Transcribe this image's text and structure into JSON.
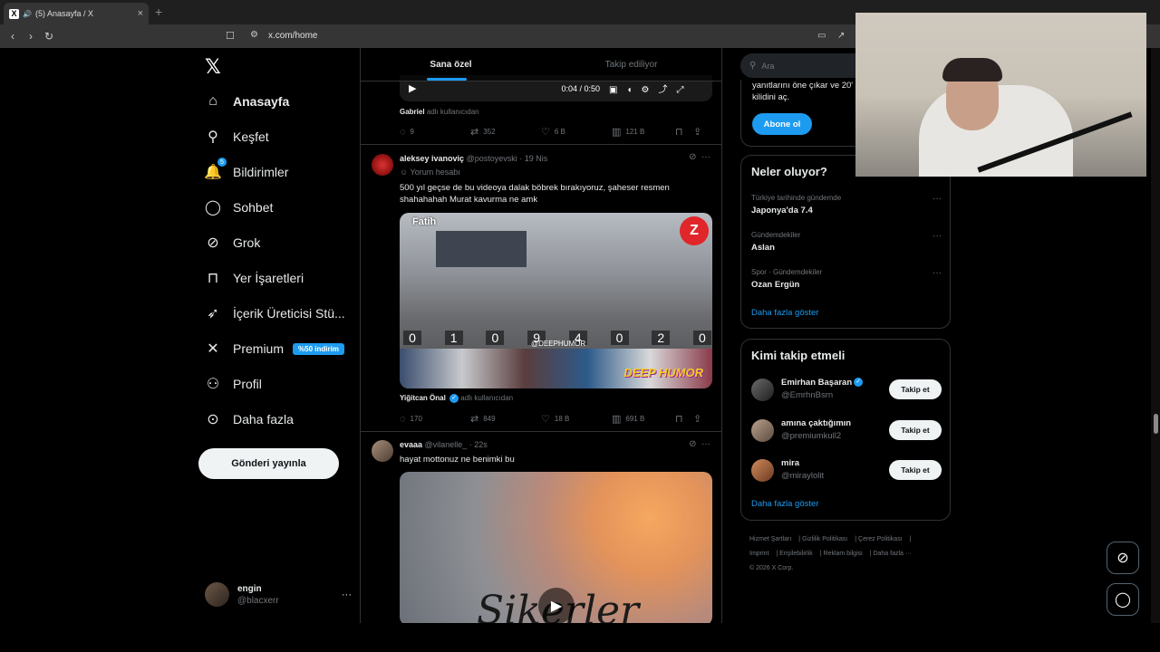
{
  "browser": {
    "tab_title": "(5) Anasayfa / X",
    "tab_icon": "x-logo-icon",
    "url": "x.com/home",
    "new_tab": "+"
  },
  "nav": {
    "items": [
      {
        "label": "Anasayfa",
        "icon": "home-icon",
        "active": true
      },
      {
        "label": "Keşfet",
        "icon": "search-icon"
      },
      {
        "label": "Bildirimler",
        "icon": "bell-icon",
        "badge": "5"
      },
      {
        "label": "Sohbet",
        "icon": "chat-icon"
      },
      {
        "label": "Grok",
        "icon": "grok-icon"
      },
      {
        "label": "Yer İşaretleri",
        "icon": "bookmark-icon"
      },
      {
        "label": "İçerik Üreticisi Stü...",
        "icon": "rocket-icon"
      },
      {
        "label": "Premium",
        "icon": "x-icon",
        "tag": "%50 indirim"
      },
      {
        "label": "Profil",
        "icon": "person-icon"
      },
      {
        "label": "Daha fazla",
        "icon": "more-circle-icon"
      }
    ],
    "post_button": "Gönderi yayınla",
    "account": {
      "name": "engin",
      "handle": "@blacxerr",
      "more": "···"
    }
  },
  "feed": {
    "tabs": [
      "Sana özel",
      "Takip ediliyor"
    ],
    "player": {
      "time": "0:04 / 0:50"
    },
    "prev_source": {
      "name": "Gabriel",
      "suffix": "adlı kullanıcıdan"
    },
    "prev_actions": {
      "replies": "9",
      "reposts": "352",
      "likes": "6 B",
      "views": "121 B"
    },
    "post1": {
      "name": "aleksey ivanoviç",
      "handle": "@postoyevski",
      "time": "· 19 Nis",
      "label": "Yorum hesabı",
      "text": "500 yıl geçse de bu videoya dalak böbrek bırakıyoruz, şaheser resmen shahahahah Murat kavurma ne amk",
      "media_tag": "Fatih",
      "media_brand": "Z",
      "digits": [
        "0",
        "1",
        "0",
        "9",
        "4",
        "0",
        "2",
        "0"
      ],
      "watermark": "@DEEPHUMOR",
      "deep": "DEEP HUMOR",
      "source": {
        "name": "Yiğitcan Önal",
        "suffix": "adlı kullanıcıdan"
      },
      "actions": {
        "replies": "170",
        "reposts": "849",
        "likes": "18 B",
        "views": "691 B"
      }
    },
    "post2": {
      "name": "evaaa",
      "handle": "@vilanelle_",
      "time": "· 22s",
      "text": "hayat mottonuz ne benimki bu",
      "media_text": "Sikerler"
    }
  },
  "right": {
    "search_placeholder": "Ara",
    "premium_text": "yanıtlarını öne çıkar ve 20' kilidini aç.",
    "subscribe": "Abone ol",
    "trends_title": "Neler oluyor?",
    "trends": [
      {
        "context": "Türkiye tarihinde gündemde",
        "name": "Japonya'da 7.4"
      },
      {
        "context": "Gündemdekiler",
        "name": "Aslan"
      },
      {
        "context": "Spor · Gündemdekiler",
        "name": "Ozan Ergün"
      }
    ],
    "show_more": "Daha fazla göster",
    "who_title": "Kimi takip etmeli",
    "who": [
      {
        "name": "Emirhan Başaran",
        "handle": "@EmrhnBsrn",
        "verified": true,
        "button": "Takip et"
      },
      {
        "name": "amına çaktığımın",
        "handle": "@premiumkull2",
        "button": "Takip et"
      },
      {
        "name": "mira",
        "handle": "@miraylolit",
        "button": "Takip et"
      }
    ],
    "who_more": "Daha fazla göster",
    "footer": [
      "Hizmet Şartları",
      "Gizlilik Politikası",
      "Çerez Politikası",
      "Imprint",
      "Erişilebilirlik",
      "Reklam bilgisi",
      "Daha fazla ···",
      "© 2026 X Corp."
    ]
  }
}
